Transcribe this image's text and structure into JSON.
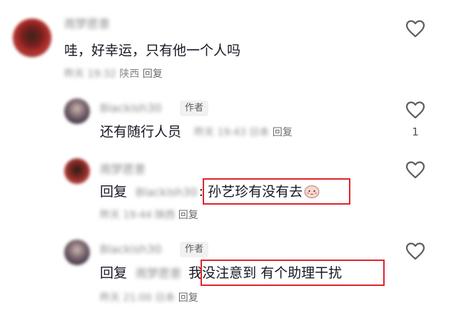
{
  "comments": [
    {
      "username": "雨梦愿意",
      "text": "哇，好幸运，只有他一个人吗",
      "time": "昨天 19:32",
      "location": "陕西",
      "reply_label": "回复"
    },
    {
      "username": "Blackish30",
      "author_tag": "作者",
      "text": "还有随行人员",
      "time_loc": "昨天 19:43 日本",
      "reply_label": "回复",
      "like_count": "1"
    },
    {
      "username": "雨梦愿意",
      "reply_prefix": "回复",
      "mention": "Blackish30",
      "highlighted_text": ": 孙艺珍有没有去",
      "time_loc": "昨天 19:44 陕西",
      "reply_label": "回复"
    },
    {
      "username": "Blackish30",
      "author_tag": "作者",
      "reply_prefix": "回复",
      "mention": "雨梦愿意",
      "highlighted_text": "我没注意到 有个助理干扰",
      "time_loc": "昨天 21:00 日本",
      "reply_label": "回复"
    }
  ],
  "colors": {
    "highlight_border": "#e0242b",
    "secondary_text": "#8a8a8a",
    "primary_text": "#161823"
  }
}
